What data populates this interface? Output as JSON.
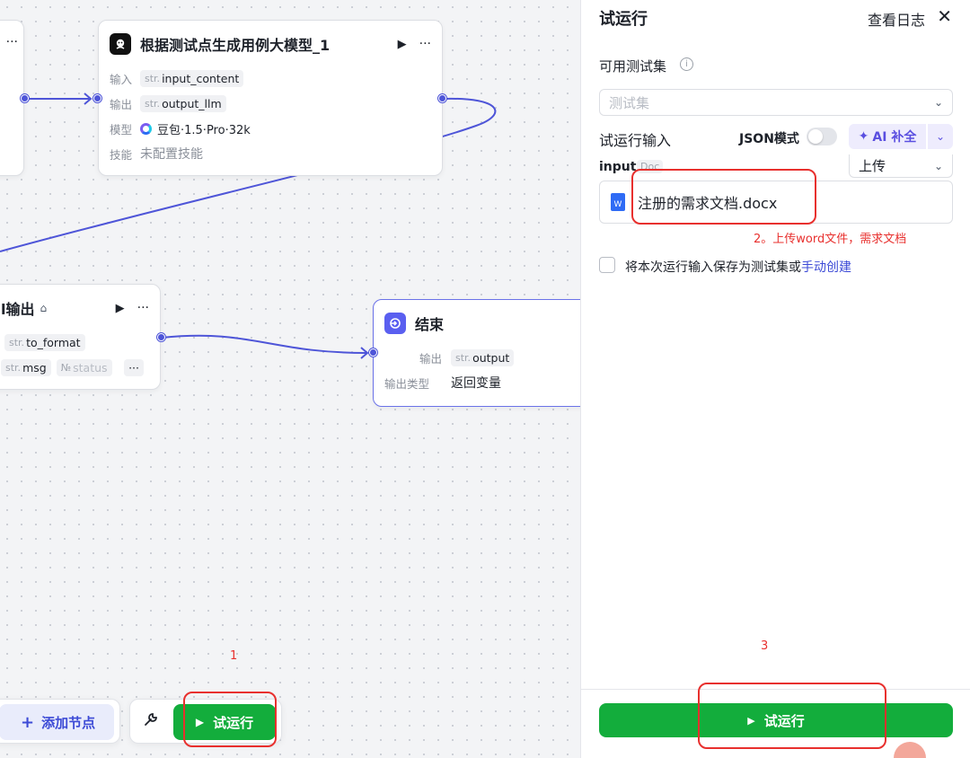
{
  "canvas": {
    "node_llm": {
      "title": "根据测试点生成用例大模型_1",
      "rows": {
        "input": {
          "key": "输入",
          "type": "str.",
          "value": "input_content"
        },
        "output": {
          "key": "输出",
          "type": "str.",
          "value": "output_llm"
        },
        "model": {
          "key": "模型",
          "value": "豆包·1.5·Pro·32k"
        },
        "skill": {
          "key": "技能",
          "value": "未配置技能"
        }
      }
    },
    "node_output": {
      "title": "l输出",
      "tag_to_format": {
        "type": "str.",
        "value": "to_format"
      },
      "tag_msg": {
        "type": "str.",
        "value": "msg"
      },
      "tag_status": {
        "type": "№",
        "value": "status"
      },
      "more": "···"
    },
    "node_end": {
      "title": "结束",
      "output_key": "输出",
      "output_type": "str.",
      "output_value": "output",
      "output_kind_key": "输出类型",
      "output_kind_value": "返回变量"
    },
    "toolbar": {
      "add_node": "添加节点",
      "run": "试运行"
    },
    "annotations": {
      "step1": "1"
    }
  },
  "panel": {
    "title": "试运行",
    "view_log": "查看日志",
    "test_set_label": "可用测试集",
    "test_set_placeholder": "测试集",
    "run_input_label": "试运行输入",
    "json_mode_label": "JSON模式",
    "ai_fill_label": "AI 补全",
    "input_label": "input",
    "input_type": "Doc",
    "upload_select": "上传",
    "file_name": "注册的需求文档.docx",
    "save_text": "将本次运行输入保存为测试集或",
    "manual_create": "手动创建",
    "run_button": "试运行",
    "annotations": {
      "step2": "2。上传word文件，需求文档",
      "step3": "3"
    }
  },
  "colors": {
    "accent": "#4e55d8",
    "green": "#13ad3c",
    "annotation_red": "#e8302e"
  }
}
